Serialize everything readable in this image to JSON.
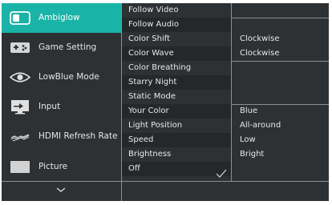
{
  "menu": {
    "main_items": [
      {
        "label": "Ambiglow",
        "icon": "ambiglow-icon",
        "selected": true
      },
      {
        "label": "Game Setting",
        "icon": "gamepad-icon",
        "selected": false
      },
      {
        "label": "LowBlue Mode",
        "icon": "eye-icon",
        "selected": false
      },
      {
        "label": "Input",
        "icon": "input-icon",
        "selected": false
      },
      {
        "label": "HDMI Refresh Rate",
        "icon": "refresh-rate-icon",
        "selected": false
      },
      {
        "label": "Picture",
        "icon": "picture-icon",
        "selected": false
      }
    ],
    "more_icon": "chevron-down-icon"
  },
  "submenu": {
    "items": [
      {
        "label": "Follow Video",
        "value": ""
      },
      {
        "label": "Follow Audio",
        "value": ""
      },
      {
        "label": "Color Shift",
        "value": "Clockwise"
      },
      {
        "label": "Color Wave",
        "value": "Clockwise"
      },
      {
        "label": "Color Breathing",
        "value": ""
      },
      {
        "label": "Starry Night",
        "value": ""
      },
      {
        "label": "Static Mode",
        "value": ""
      },
      {
        "label": "Your Color",
        "value": "Blue"
      },
      {
        "label": "Light Position",
        "value": "All-around"
      },
      {
        "label": "Speed",
        "value": "Low"
      },
      {
        "label": "Brightness",
        "value": "Bright"
      },
      {
        "label": "Off",
        "value": "",
        "checked": true
      }
    ]
  },
  "colors": {
    "selected_accent": "#1ab3a7",
    "background": "#2d3134",
    "divider": "#8a8f93",
    "text": "#e8e8e8"
  }
}
